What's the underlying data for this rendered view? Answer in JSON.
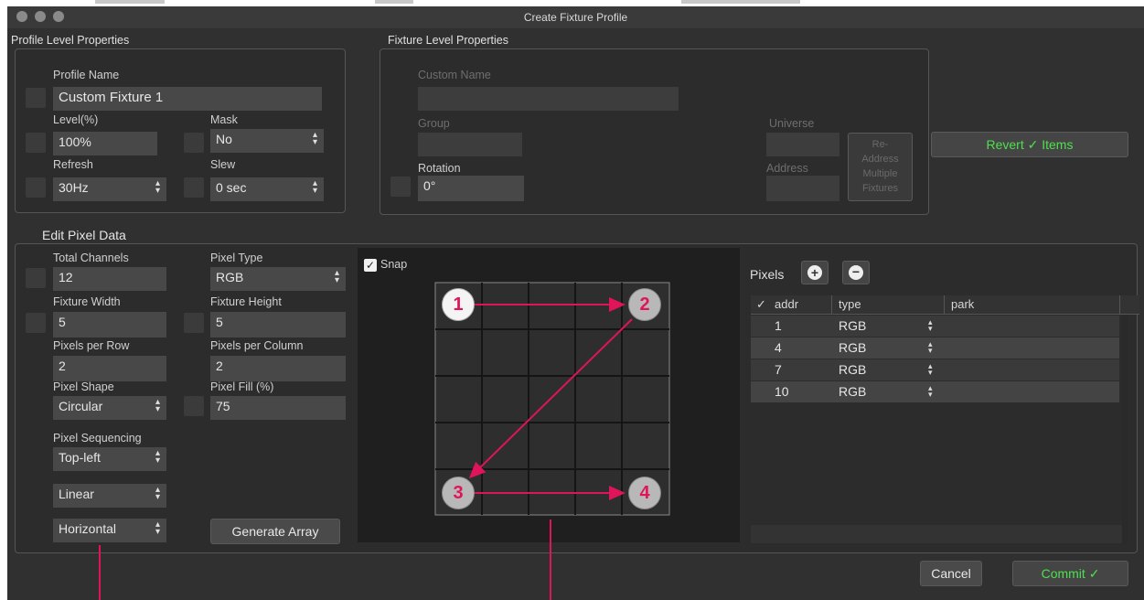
{
  "window": {
    "title": "Create Fixture Profile"
  },
  "profile": {
    "section": "Profile Level Properties",
    "name_label": "Profile Name",
    "name_value": "Custom Fixture 1",
    "level_label": "Level(%)",
    "level_value": "100%",
    "mask_label": "Mask",
    "mask_value": "No",
    "refresh_label": "Refresh",
    "refresh_value": "30Hz",
    "slew_label": "Slew",
    "slew_value": "0 sec"
  },
  "fixture": {
    "section": "Fixture Level Properties",
    "custom_name_label": "Custom Name",
    "group_label": "Group",
    "universe_label": "Universe",
    "address_label": "Address",
    "rotation_label": "Rotation",
    "rotation_value": "0°",
    "readdress_label": "Re-\nAddress\nMultiple\nFixtures"
  },
  "revert_label": "Revert ✓ Items",
  "pixel_data": {
    "section": "Edit Pixel Data",
    "total_channels_label": "Total Channels",
    "total_channels_value": "12",
    "pixel_type_label": "Pixel Type",
    "pixel_type_value": "RGB",
    "fixture_width_label": "Fixture Width",
    "fixture_width_value": "5",
    "fixture_height_label": "Fixture Height",
    "fixture_height_value": "5",
    "pixels_per_row_label": "Pixels per Row",
    "pixels_per_row_value": "2",
    "pixels_per_column_label": "Pixels per Column",
    "pixels_per_column_value": "2",
    "pixel_shape_label": "Pixel Shape",
    "pixel_shape_value": "Circular",
    "pixel_fill_label": "Pixel Fill (%)",
    "pixel_fill_value": "75",
    "sequencing_label": "Pixel Sequencing",
    "sequencing_start": "Top-left",
    "sequencing_mode": "Linear",
    "sequencing_direction": "Horizontal",
    "generate_label": "Generate Array"
  },
  "canvas": {
    "snap_label": "Snap",
    "snap_checked": true,
    "markers": [
      "1",
      "2",
      "3",
      "4"
    ]
  },
  "pixels": {
    "title": "Pixels",
    "columns": [
      "✓",
      "addr",
      "type",
      "park"
    ],
    "rows": [
      {
        "addr": "1",
        "type": "RGB"
      },
      {
        "addr": "4",
        "type": "RGB"
      },
      {
        "addr": "7",
        "type": "RGB"
      },
      {
        "addr": "10",
        "type": "RGB"
      }
    ]
  },
  "footer": {
    "cancel_label": "Cancel",
    "commit_label": "Commit ✓"
  },
  "colors": {
    "accent_green": "#4ee04e",
    "arrow": "#e0145a"
  }
}
